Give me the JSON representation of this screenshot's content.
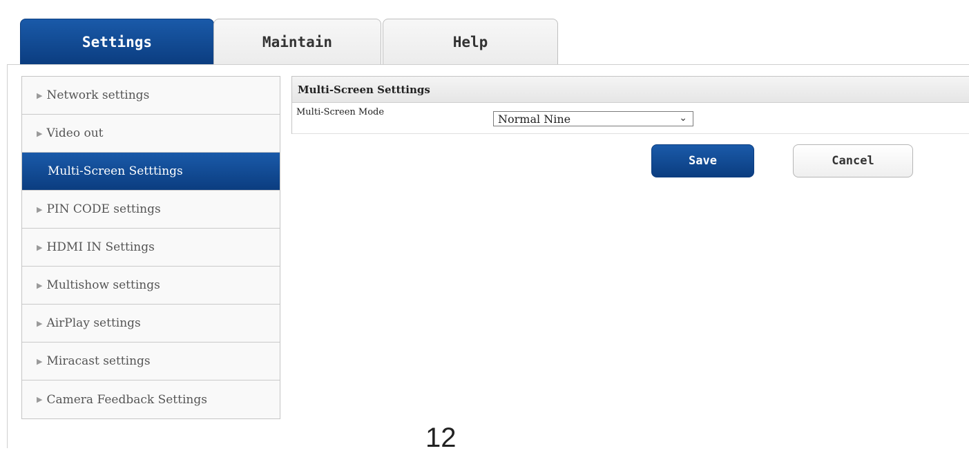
{
  "tabs": [
    {
      "label": "Settings",
      "active": true
    },
    {
      "label": "Maintain",
      "active": false
    },
    {
      "label": "Help",
      "active": false
    }
  ],
  "sidebar": {
    "items": [
      {
        "label": "Network settings",
        "active": false
      },
      {
        "label": "Video out",
        "active": false
      },
      {
        "label": "Multi-Screen Setttings",
        "active": true
      },
      {
        "label": "PIN CODE settings",
        "active": false
      },
      {
        "label": "HDMI IN Settings",
        "active": false
      },
      {
        "label": "Multishow settings",
        "active": false
      },
      {
        "label": "AirPlay settings",
        "active": false
      },
      {
        "label": "Miracast settings",
        "active": false
      },
      {
        "label": "Camera Feedback Settings",
        "active": false
      }
    ]
  },
  "panel": {
    "title": "Multi-Screen Setttings",
    "mode_label": "Multi-Screen Mode",
    "mode_value": "Normal Nine"
  },
  "buttons": {
    "save": "Save",
    "cancel": "Cancel"
  },
  "page_number": "12",
  "colors": {
    "accent": "#0b3d80",
    "accent_light": "#1a5aa9",
    "border": "#c4c4c4"
  },
  "icons": {
    "sidebar_arrow": "triangle-right-icon",
    "select_chevron": "chevron-down-icon"
  }
}
